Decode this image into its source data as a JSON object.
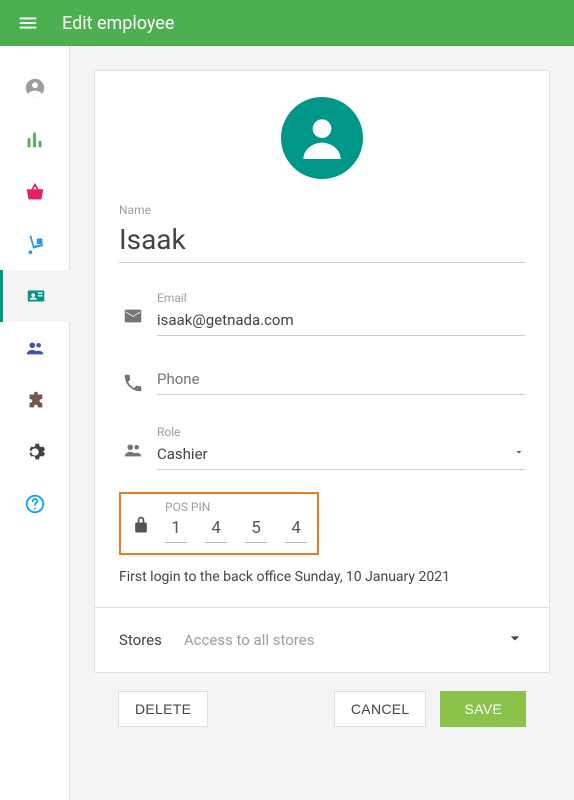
{
  "header": {
    "title": "Edit employee"
  },
  "form": {
    "name_label": "Name",
    "name_value": "Isaak",
    "email_label": "Email",
    "email_value": "isaak@getnada.com",
    "phone_placeholder": "Phone",
    "role_label": "Role",
    "role_value": "Cashier",
    "pin_label": "POS PIN",
    "pin_digits": [
      "1",
      "4",
      "5",
      "4"
    ],
    "first_login": "First login to the back office Sunday, 10 January 2021",
    "stores_label": "Stores",
    "stores_value": "Access to all stores"
  },
  "footer": {
    "delete": "DELETE",
    "cancel": "CANCEL",
    "save": "SAVE"
  }
}
